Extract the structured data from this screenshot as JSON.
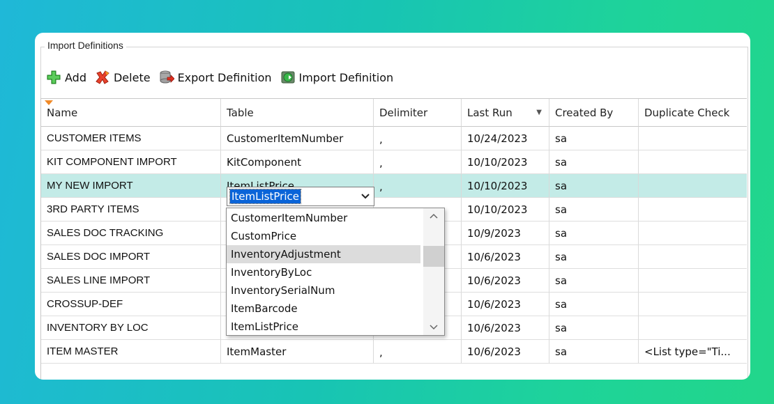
{
  "group_title": "Import Definitions",
  "toolbar": {
    "add_label": "Add",
    "delete_label": "Delete",
    "export_label": "Export Definition",
    "import_label": "Import Definition"
  },
  "columns": {
    "name": "Name",
    "table": "Table",
    "delimiter": "Delimiter",
    "last_run": "Last Run",
    "created_by": "Created By",
    "duplicate_check": "Duplicate Check"
  },
  "rows": [
    {
      "name": "CUSTOMER ITEMS",
      "table": "CustomerItemNumber",
      "delimiter": ",",
      "last_run": "10/24/2023",
      "created_by": "sa",
      "duplicate_check": ""
    },
    {
      "name": "KIT COMPONENT IMPORT",
      "table": "KitComponent",
      "delimiter": ",",
      "last_run": "10/10/2023",
      "created_by": "sa",
      "duplicate_check": ""
    },
    {
      "name": "MY NEW IMPORT",
      "table": "ItemListPrice",
      "delimiter": ",",
      "last_run": "10/10/2023",
      "created_by": "sa",
      "duplicate_check": ""
    },
    {
      "name": "3RD PARTY ITEMS",
      "table": "",
      "delimiter": "",
      "last_run": "10/10/2023",
      "created_by": "sa",
      "duplicate_check": ""
    },
    {
      "name": "SALES DOC TRACKING",
      "table": "",
      "delimiter": "",
      "last_run": "10/9/2023",
      "created_by": "sa",
      "duplicate_check": ""
    },
    {
      "name": "SALES DOC IMPORT",
      "table": "",
      "delimiter": "",
      "last_run": "10/6/2023",
      "created_by": "sa",
      "duplicate_check": ""
    },
    {
      "name": "SALES LINE IMPORT",
      "table": "",
      "delimiter": "",
      "last_run": "10/6/2023",
      "created_by": "sa",
      "duplicate_check": ""
    },
    {
      "name": "CROSSUP-DEF",
      "table": "",
      "delimiter": "",
      "last_run": "10/6/2023",
      "created_by": "sa",
      "duplicate_check": ""
    },
    {
      "name": "INVENTORY BY LOC",
      "table": "InventoryByLoc",
      "delimiter": ",",
      "last_run": "10/6/2023",
      "created_by": "sa",
      "duplicate_check": ""
    },
    {
      "name": "ITEM MASTER",
      "table": "ItemMaster",
      "delimiter": ",",
      "last_run": "10/6/2023",
      "created_by": "sa",
      "duplicate_check": "<List type=\"Ti..."
    }
  ],
  "editor": {
    "value": "ItemListPrice"
  },
  "dropdown_items": [
    "CustomerItemNumber",
    "CustomPrice",
    "InventoryAdjustment",
    "InventoryByLoc",
    "InventorySerialNum",
    "ItemBarcode",
    "ItemListPrice"
  ],
  "highlighted_dropdown_item": "InventoryAdjustment",
  "icons": {
    "add": "green-plus-icon",
    "delete": "red-x-icon",
    "export": "database-export-icon",
    "import": "database-import-icon"
  }
}
